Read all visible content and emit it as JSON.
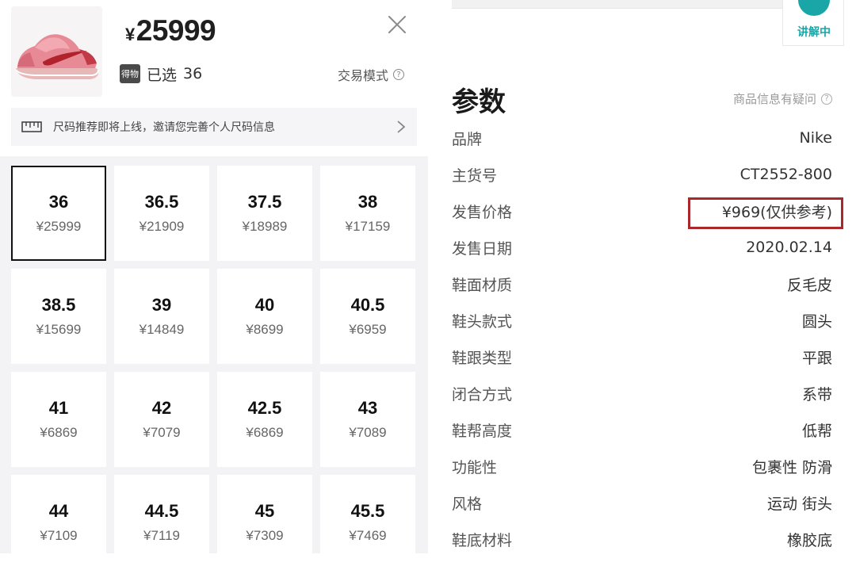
{
  "header": {
    "price_symbol": "¥",
    "price_value": "25999",
    "badge_text": "得物",
    "selected_label": "已选",
    "selected_size": "36",
    "trade_mode_label": "交易模式"
  },
  "size_banner": {
    "text": "尺码推荐即将上线，邀请您完善个人尺码信息"
  },
  "sizes": [
    {
      "size": "36",
      "price": "¥25999",
      "selected": true
    },
    {
      "size": "36.5",
      "price": "¥21909"
    },
    {
      "size": "37.5",
      "price": "¥18989"
    },
    {
      "size": "38",
      "price": "¥17159"
    },
    {
      "size": "38.5",
      "price": "¥15699"
    },
    {
      "size": "39",
      "price": "¥14849"
    },
    {
      "size": "40",
      "price": "¥8699"
    },
    {
      "size": "40.5",
      "price": "¥6959"
    },
    {
      "size": "41",
      "price": "¥6869"
    },
    {
      "size": "42",
      "price": "¥7079"
    },
    {
      "size": "42.5",
      "price": "¥6869"
    },
    {
      "size": "43",
      "price": "¥7089"
    },
    {
      "size": "44",
      "price": "¥7109"
    },
    {
      "size": "44.5",
      "price": "¥7119"
    },
    {
      "size": "45",
      "price": "¥7309"
    },
    {
      "size": "45.5",
      "price": "¥7469"
    }
  ],
  "right_panel": {
    "explain_label": "讲解中",
    "params_title": "参数",
    "question_link": "商品信息有疑问",
    "params": [
      {
        "key": "品牌",
        "value": "Nike"
      },
      {
        "key": "主货号",
        "value": "CT2552-800"
      },
      {
        "key": "发售价格",
        "value": "¥969(仅供参考)",
        "highlighted": true
      },
      {
        "key": "发售日期",
        "value": "2020.02.14"
      },
      {
        "key": "鞋面材质",
        "value": "反毛皮"
      },
      {
        "key": "鞋头款式",
        "value": "圆头"
      },
      {
        "key": "鞋跟类型",
        "value": "平跟"
      },
      {
        "key": "闭合方式",
        "value": "系带"
      },
      {
        "key": "鞋帮高度",
        "value": "低帮"
      },
      {
        "key": "功能性",
        "value": "包裹性  防滑"
      },
      {
        "key": "风格",
        "value": "运动  街头"
      },
      {
        "key": "鞋底材料",
        "value": "橡胶底"
      }
    ]
  },
  "colors": {
    "highlight_border": "#a8282c",
    "accent_teal": "#1aa6a6",
    "grid_background": "#f3f3f5"
  },
  "icons": {
    "close": "close-icon",
    "ruler": "ruler-icon",
    "chevron": "chevron-right-icon",
    "help": "help-circle-icon"
  }
}
